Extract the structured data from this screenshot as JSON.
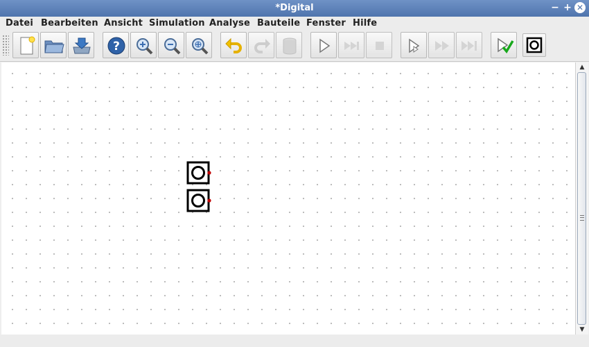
{
  "window": {
    "title": "*Digital"
  },
  "window_controls": {
    "minimize": "−",
    "maximize": "+",
    "close": "✕"
  },
  "menu": [
    {
      "id": "datei",
      "label": "Datei"
    },
    {
      "id": "bearbeiten",
      "label": "Bearbeiten"
    },
    {
      "id": "ansicht",
      "label": "Ansicht"
    },
    {
      "id": "simulation",
      "label": "Simulation"
    },
    {
      "id": "analyse",
      "label": "Analyse"
    },
    {
      "id": "bauteile",
      "label": "Bauteile"
    },
    {
      "id": "fenster",
      "label": "Fenster"
    },
    {
      "id": "hilfe",
      "label": "Hilfe"
    }
  ],
  "toolbar": [
    {
      "icon": "new-file-icon",
      "enabled": true
    },
    {
      "icon": "open-folder-icon",
      "enabled": true
    },
    {
      "icon": "save-icon",
      "enabled": true
    },
    {
      "icon": "help-icon",
      "enabled": true
    },
    {
      "icon": "zoom-in-icon",
      "enabled": true
    },
    {
      "icon": "zoom-out-icon",
      "enabled": true
    },
    {
      "icon": "zoom-fit-icon",
      "enabled": true
    },
    {
      "icon": "undo-icon",
      "enabled": true
    },
    {
      "icon": "redo-icon",
      "enabled": false
    },
    {
      "icon": "delete-icon",
      "enabled": false
    },
    {
      "icon": "start-simulation-icon",
      "enabled": true
    },
    {
      "icon": "step-forward-icon",
      "enabled": false
    },
    {
      "icon": "stop-icon",
      "enabled": false
    },
    {
      "icon": "start-micro-step-icon",
      "enabled": true
    },
    {
      "icon": "micro-step-icon",
      "enabled": false
    },
    {
      "icon": "run-to-break-icon",
      "enabled": false
    },
    {
      "icon": "run-tests-icon",
      "enabled": true
    },
    {
      "icon": "component-icon",
      "enabled": true
    }
  ],
  "colors": {
    "titlebar": "#5b7fb8",
    "pin": "#c00000",
    "canvas": "#ffffff",
    "grid_dot": "#b5b5b5"
  },
  "components": [
    {
      "type": "clock-input",
      "icon": "clock-input-icon"
    },
    {
      "type": "clock-input",
      "icon": "clock-input-icon"
    }
  ]
}
